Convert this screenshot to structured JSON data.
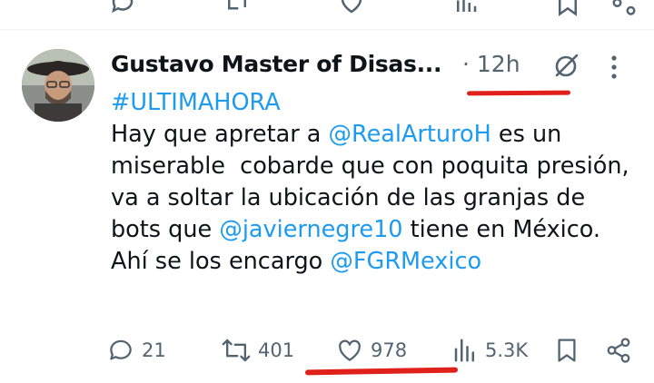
{
  "tweet": {
    "author_name": "Gustavo Master of Disas...",
    "time_separator": "·",
    "time": "12h",
    "hashtag": "#ULTIMAHORA",
    "text_part1": "Hay que apretar a ",
    "mention1": "@RealArturoH",
    "text_part2": " es un miserable  cobarde que con poquita presión, va a soltar la ubicación de las granjas de bots que ",
    "mention2": "@javiernegre10",
    "text_part3": " tiene en México. Ahí se los encargo ",
    "mention3": "@FGRMexico"
  },
  "actions": {
    "replies": "21",
    "reposts": "401",
    "likes": "978",
    "views": "5.3K"
  },
  "icons": [
    "reply-icon",
    "repost-icon",
    "like-icon",
    "views-icon",
    "bookmark-icon",
    "share-icon",
    "grok-icon",
    "more-icon"
  ],
  "colors": {
    "link": "#1d9bf0",
    "muted": "#536471",
    "annotation": "#e0211b"
  }
}
